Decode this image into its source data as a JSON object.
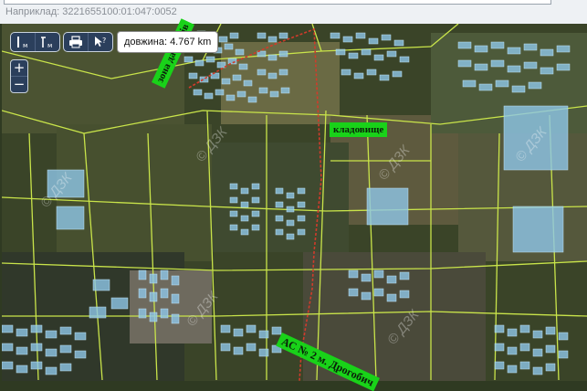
{
  "search": {
    "hint_label": "Наприклад: 3221655100:01:047:0052"
  },
  "map": {
    "distance_readout": "довжина: 4.767 km",
    "watermark_text": "© ДЗК",
    "labels": {
      "zones": "зона дачників",
      "cemetery": "кладовище",
      "station": "АС № 2 м. Дрогобич"
    },
    "zoom": {
      "in_label": "+",
      "out_label": "−"
    },
    "colors": {
      "parcel_outline": "#c9e44a",
      "building_fill": "#8fc7e8",
      "measure_line": "#d13b2b",
      "label_background": "#19d219"
    }
  },
  "toolbar": {
    "icons": [
      "measure-distance-icon",
      "measure-area-icon",
      "print-icon",
      "identify-info-icon"
    ]
  }
}
